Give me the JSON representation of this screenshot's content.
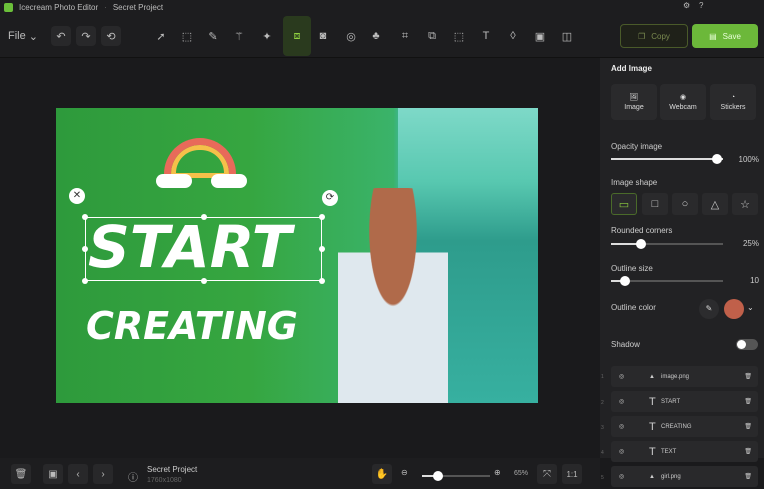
{
  "app": {
    "title": "Icecream Photo Editor",
    "project": "Secret Project"
  },
  "toolbar": {
    "file": "File",
    "copy": "Copy",
    "save": "Save"
  },
  "canvas": {
    "text1": "START",
    "text2": "CREATING"
  },
  "panel": {
    "add_image": "Add Image",
    "buttons": [
      "Image",
      "Webcam",
      "Stickers"
    ],
    "opacity": {
      "label": "Opacity image",
      "value": "100%",
      "level": 100
    },
    "shape_label": "Image shape",
    "rounded": {
      "label": "Rounded corners",
      "value": "25%",
      "level": 25
    },
    "outline_size": {
      "label": "Outline size",
      "value": "10",
      "level": 10
    },
    "outline_color": {
      "label": "Outline color",
      "color": "#c0604a"
    },
    "shadow": {
      "label": "Shadow",
      "on": false
    }
  },
  "layers": [
    {
      "num": "1",
      "name": "image.png",
      "type": "image"
    },
    {
      "num": "2",
      "name": "START",
      "type": "text"
    },
    {
      "num": "3",
      "name": "CREATING",
      "type": "text"
    },
    {
      "num": "4",
      "name": "TEXT",
      "type": "text"
    },
    {
      "num": "5",
      "name": "girl.png",
      "type": "image"
    }
  ],
  "bottom": {
    "project": "Secret Project",
    "size": "1760x1080",
    "zoom": "65%",
    "zoom_level": 65,
    "actual": "1:1"
  },
  "colors": {
    "accent": "#6cb83a"
  }
}
